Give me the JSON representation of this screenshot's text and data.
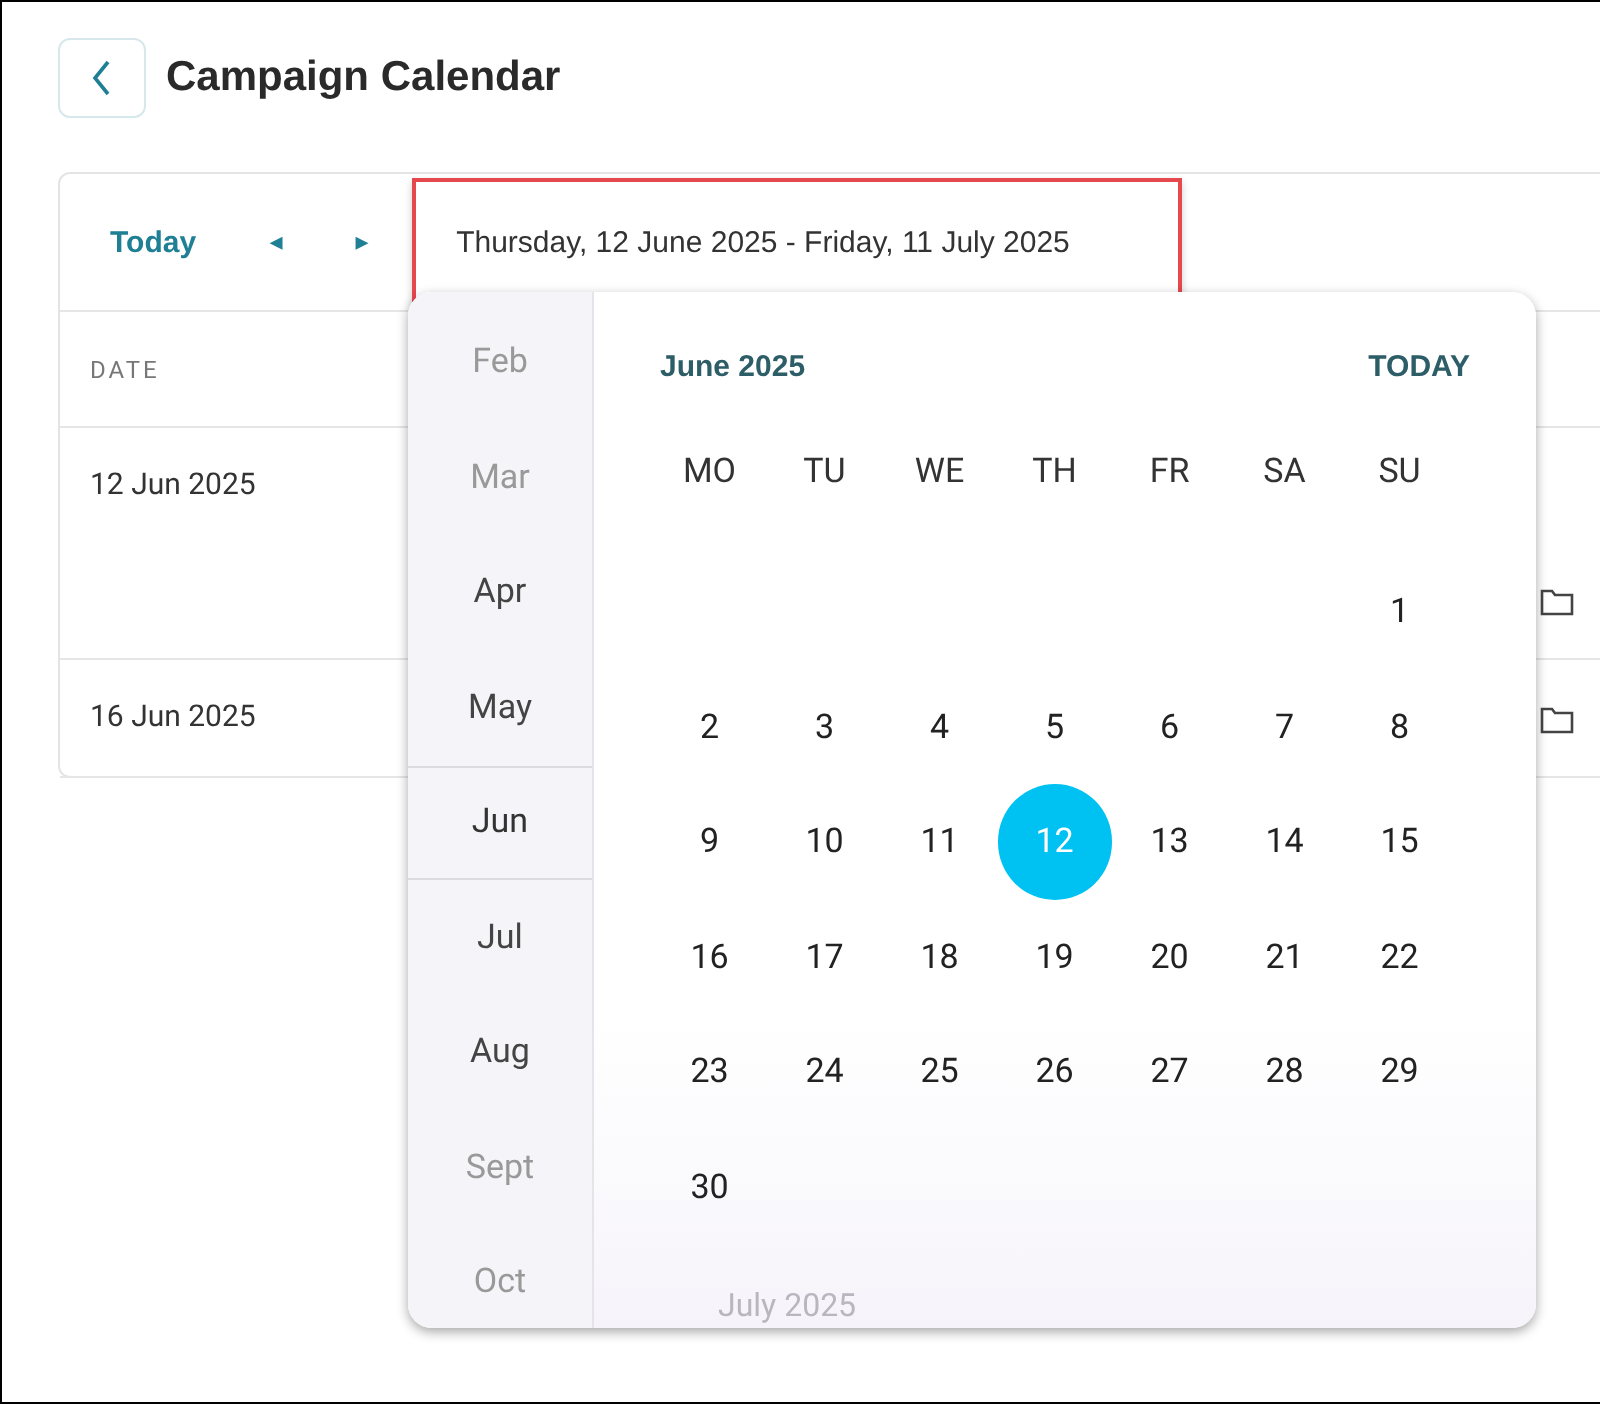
{
  "page": {
    "title": "Campaign Calendar"
  },
  "toolbar": {
    "today": "Today",
    "prev": "◂",
    "next": "▸",
    "date_range": "Thursday, 12 June 2025 - Friday, 11 July 2025"
  },
  "table": {
    "columns": [
      "DATE"
    ],
    "rows": [
      {
        "date": "12 Jun 2025"
      },
      {
        "date": "16 Jun 2025"
      }
    ]
  },
  "date_picker": {
    "months": [
      {
        "label": "Feb",
        "selected": false
      },
      {
        "label": "Mar",
        "selected": false
      },
      {
        "label": "Apr",
        "selected": false
      },
      {
        "label": "May",
        "selected": false
      },
      {
        "label": "Jun",
        "selected": true
      },
      {
        "label": "Jul",
        "selected": false
      },
      {
        "label": "Aug",
        "selected": false
      },
      {
        "label": "Sept",
        "selected": false
      },
      {
        "label": "Oct",
        "selected": false
      }
    ],
    "month_title": "June 2025",
    "today": "TODAY",
    "weekdays": [
      "MO",
      "TU",
      "WE",
      "TH",
      "FR",
      "SA",
      "SU"
    ],
    "weeks": [
      {
        "kind": "trailing",
        "days": [
          {
            "label": "1",
            "selected": false
          }
        ]
      },
      {
        "kind": "full",
        "days": [
          {
            "label": "2",
            "selected": false
          },
          {
            "label": "3",
            "selected": false
          },
          {
            "label": "4",
            "selected": false
          },
          {
            "label": "5",
            "selected": false
          },
          {
            "label": "6",
            "selected": false
          },
          {
            "label": "7",
            "selected": false
          },
          {
            "label": "8",
            "selected": false
          }
        ]
      },
      {
        "kind": "full",
        "days": [
          {
            "label": "9",
            "selected": false
          },
          {
            "label": "10",
            "selected": false
          },
          {
            "label": "11",
            "selected": false
          },
          {
            "label": "12",
            "selected": true
          },
          {
            "label": "13",
            "selected": false
          },
          {
            "label": "14",
            "selected": false
          },
          {
            "label": "15",
            "selected": false
          }
        ]
      },
      {
        "kind": "full",
        "days": [
          {
            "label": "16",
            "selected": false
          },
          {
            "label": "17",
            "selected": false
          },
          {
            "label": "18",
            "selected": false
          },
          {
            "label": "19",
            "selected": false
          },
          {
            "label": "20",
            "selected": false
          },
          {
            "label": "21",
            "selected": false
          },
          {
            "label": "22",
            "selected": false
          }
        ]
      },
      {
        "kind": "full",
        "days": [
          {
            "label": "23",
            "selected": false
          },
          {
            "label": "24",
            "selected": false
          },
          {
            "label": "25",
            "selected": false
          },
          {
            "label": "26",
            "selected": false
          },
          {
            "label": "27",
            "selected": false
          },
          {
            "label": "28",
            "selected": false
          },
          {
            "label": "29",
            "selected": false
          }
        ]
      },
      {
        "kind": "leading",
        "days": [
          {
            "label": "30",
            "selected": false
          }
        ]
      }
    ],
    "next_month_title": "July 2025"
  }
}
